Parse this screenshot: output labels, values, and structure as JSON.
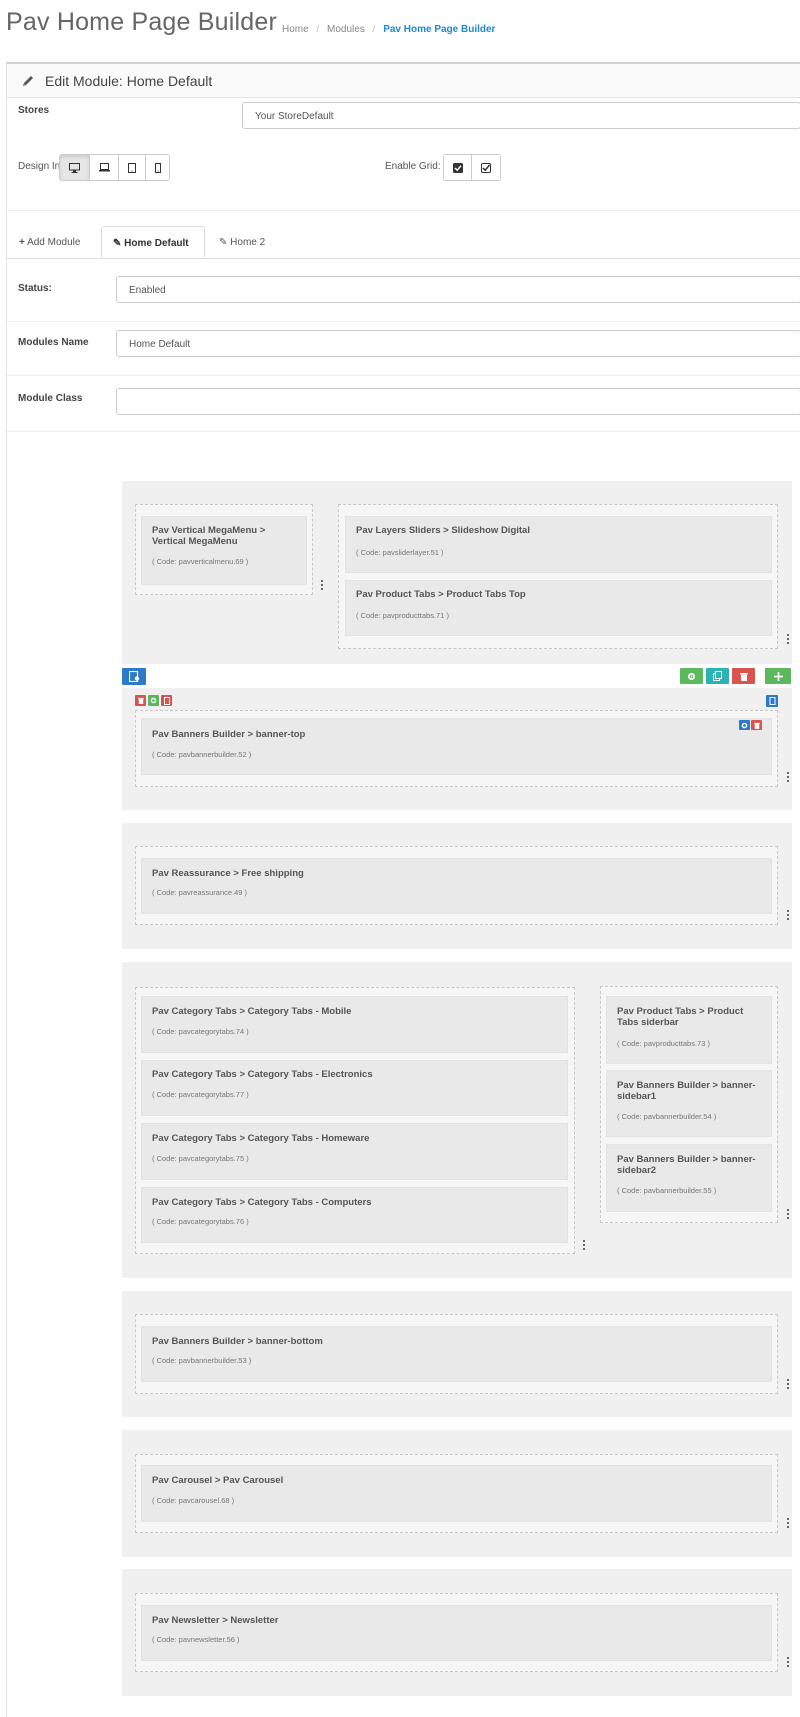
{
  "header": {
    "title": "Pav Home Page Builder",
    "breadcrumb": [
      "Home",
      "Modules",
      "Pav Home Page Builder"
    ],
    "separator": "/"
  },
  "panel": {
    "title": "Edit Module: Home Default"
  },
  "form": {
    "stores_label": "Stores",
    "stores_value": "Your StoreDefault",
    "design_in_label": "Design In",
    "enable_grid_label": "Enable Grid:",
    "status_label": "Status:",
    "status_value": "Enabled",
    "modules_name_label": "Modules Name",
    "modules_name_value": "Home  Default",
    "module_class_label": "Module Class",
    "module_class_value": ""
  },
  "tabs": [
    {
      "label": "Add Module",
      "icon": "plus-icon"
    },
    {
      "label": "Home Default",
      "icon": "pencil-icon",
      "active": true
    },
    {
      "label": "Home 2",
      "icon": "pencil-icon"
    }
  ],
  "rows": [
    {
      "widgets": [
        {
          "title": "Pav Vertical MegaMenu > Vertical MegaMenu",
          "code": "( Code: pavverticalmenu.69 )"
        },
        {
          "title": "Pav Layers Sliders > Slideshow Digital",
          "code": "( Code: pavsliderlayer.51 )"
        },
        {
          "title": "Pav Product Tabs > Product Tabs Top",
          "code": "( Code: pavproducttabs.71 )"
        }
      ]
    },
    {
      "widgets": [
        {
          "title": "Pav Banners Builder > banner-top",
          "code": "( Code: pavbannerbuilder.52 )"
        }
      ]
    },
    {
      "widgets": [
        {
          "title": "Pav Reassurance > Free shipping",
          "code": "( Code: pavreassurance.49 )"
        }
      ]
    },
    {
      "widgets": [
        {
          "title": "Pav Category Tabs > Category Tabs - Mobile",
          "code": "( Code: pavcategorytabs.74 )"
        },
        {
          "title": "Pav Category Tabs > Category Tabs - Electronics",
          "code": "( Code: pavcategorytabs.77 )"
        },
        {
          "title": "Pav Category Tabs > Category Tabs - Homeware",
          "code": "( Code: pavcategorytabs.75 )"
        },
        {
          "title": "Pav Category Tabs > Category Tabs - Computers",
          "code": "( Code: pavcategorytabs.76 )"
        },
        {
          "title": "Pav Product Tabs > Product Tabs siderbar",
          "code": "( Code: pavproducttabs.73 )"
        },
        {
          "title": "Pav Banners Builder > banner-sidebar1",
          "code": "( Code: pavbannerbuilder.54 )"
        },
        {
          "title": "Pav Banners Builder > banner-sidebar2",
          "code": "( Code: pavbannerbuilder.55 )"
        }
      ]
    },
    {
      "widgets": [
        {
          "title": "Pav Banners Builder > banner-bottom",
          "code": "( Code: pavbannerbuilder.53 )"
        }
      ]
    },
    {
      "widgets": [
        {
          "title": "Pav Carousel > Pav Carousel",
          "code": "( Code: pavcarousel.68 )"
        }
      ]
    },
    {
      "widgets": [
        {
          "title": "Pav Newsletter > Newsletter",
          "code": "( Code: pavnewsletter.56 )"
        }
      ]
    }
  ],
  "colors": {
    "accent": "#1e88d2",
    "green": "#5cb85c",
    "teal": "#2bb3b3",
    "red": "#d9534f",
    "blue": "#2b7bc9"
  }
}
